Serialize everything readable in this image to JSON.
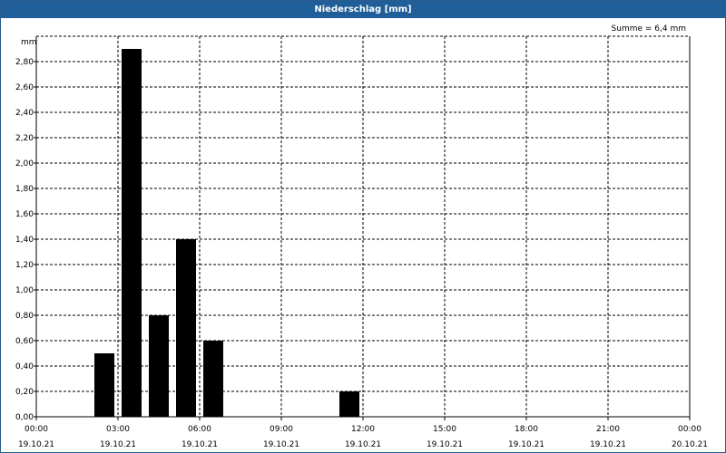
{
  "window": {
    "title": "Niederschlag [mm]"
  },
  "chart_data": {
    "type": "bar",
    "title": "Niederschlag [mm]",
    "unit_label": "mm",
    "annotation": "Summe = 6,4 mm",
    "ylim": [
      0,
      3.0
    ],
    "yticks": [
      0.0,
      0.2,
      0.4,
      0.6,
      0.8,
      1.0,
      1.2,
      1.4,
      1.6,
      1.8,
      2.0,
      2.2,
      2.4,
      2.6,
      2.8
    ],
    "ytick_labels": [
      "0,00",
      "0,20",
      "0,40",
      "0,60",
      "0,80",
      "1,00",
      "1,20",
      "1,40",
      "1,60",
      "1,80",
      "2,00",
      "2,20",
      "2,40",
      "2,60",
      "2,80"
    ],
    "xlim_hours": [
      0,
      24
    ],
    "xticks": [
      {
        "hour": 0,
        "time": "00:00",
        "date": "19.10.21"
      },
      {
        "hour": 3,
        "time": "03:00",
        "date": "19.10.21"
      },
      {
        "hour": 6,
        "time": "06:00",
        "date": "19.10.21"
      },
      {
        "hour": 9,
        "time": "09:00",
        "date": "19.10.21"
      },
      {
        "hour": 12,
        "time": "12:00",
        "date": "19.10.21"
      },
      {
        "hour": 15,
        "time": "15:00",
        "date": "19.10.21"
      },
      {
        "hour": 18,
        "time": "18:00",
        "date": "19.10.21"
      },
      {
        "hour": 21,
        "time": "21:00",
        "date": "19.10.21"
      },
      {
        "hour": 24,
        "time": "00:00",
        "date": "20.10.21"
      }
    ],
    "bars": [
      {
        "hour": 2.5,
        "value": 0.5
      },
      {
        "hour": 3.5,
        "value": 2.9
      },
      {
        "hour": 4.5,
        "value": 0.8
      },
      {
        "hour": 5.5,
        "value": 1.4
      },
      {
        "hour": 6.5,
        "value": 0.6
      },
      {
        "hour": 11.5,
        "value": 0.2
      }
    ],
    "grid": true,
    "bar_color": "#000000"
  }
}
